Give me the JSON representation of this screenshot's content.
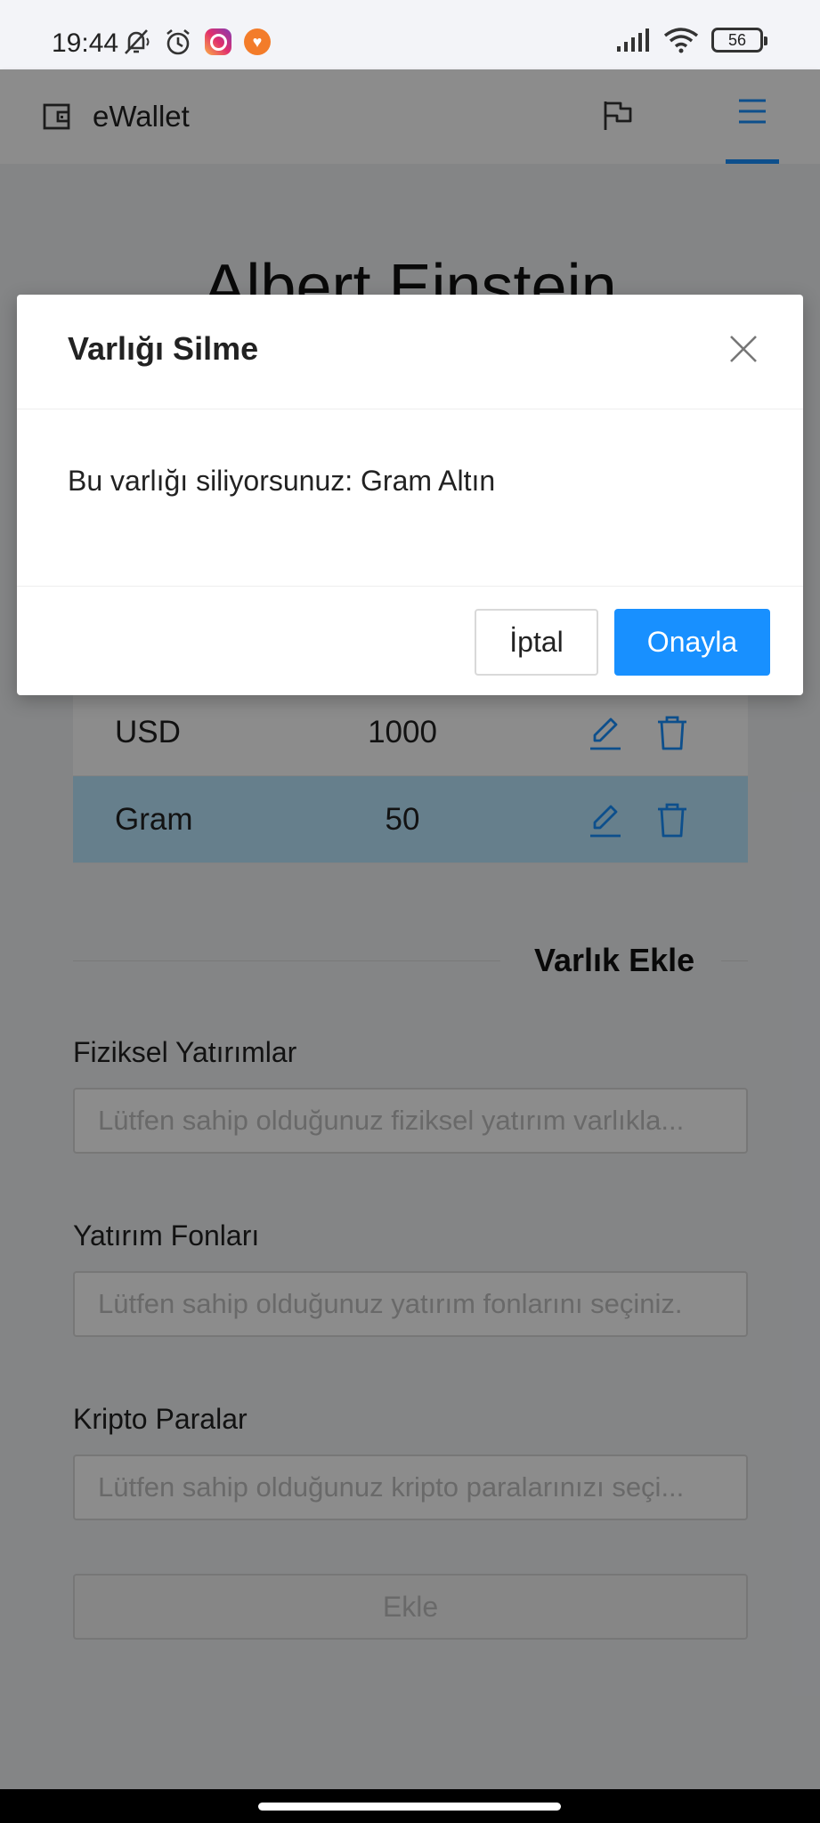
{
  "status_bar": {
    "time": "19:44",
    "left_icons": [
      "mute-bell-icon",
      "alarm-icon",
      "instagram-icon",
      "heart-app-icon"
    ],
    "right_icons": [
      "signal-icon",
      "wifi-icon",
      "battery-icon"
    ],
    "battery": "56"
  },
  "app_bar": {
    "title": "eWallet",
    "logo_icon": "wallet-icon",
    "flag_icon": "flag-icon",
    "menu_icon": "hamburger-menu-icon",
    "accent_color": "#1890ff"
  },
  "profile": {
    "name": "Albert Einstein"
  },
  "assets_table": {
    "rows": [
      {
        "name": "USD",
        "amount": "1000",
        "selected": false
      },
      {
        "name": "Gram",
        "amount": "50",
        "selected": true
      }
    ]
  },
  "add_section": {
    "title": "Varlık Ekle",
    "fields": [
      {
        "label": "Fiziksel Yatırımlar",
        "placeholder": "Lütfen sahip olduğunuz fiziksel yatırım varlıkla..."
      },
      {
        "label": "Yatırım Fonları",
        "placeholder": "Lütfen sahip olduğunuz yatırım fonlarını seçiniz."
      },
      {
        "label": "Kripto Paralar",
        "placeholder": "Lütfen sahip olduğunuz kripto paralarınızı seçi..."
      }
    ],
    "add_button": "Ekle"
  },
  "modal": {
    "title": "Varlığı Silme",
    "message": "Bu varlığı siliyorsunuz: Gram Altın",
    "cancel_label": "İptal",
    "confirm_label": "Onayla",
    "close_icon": "close-icon",
    "confirm_color": "#1890ff"
  }
}
